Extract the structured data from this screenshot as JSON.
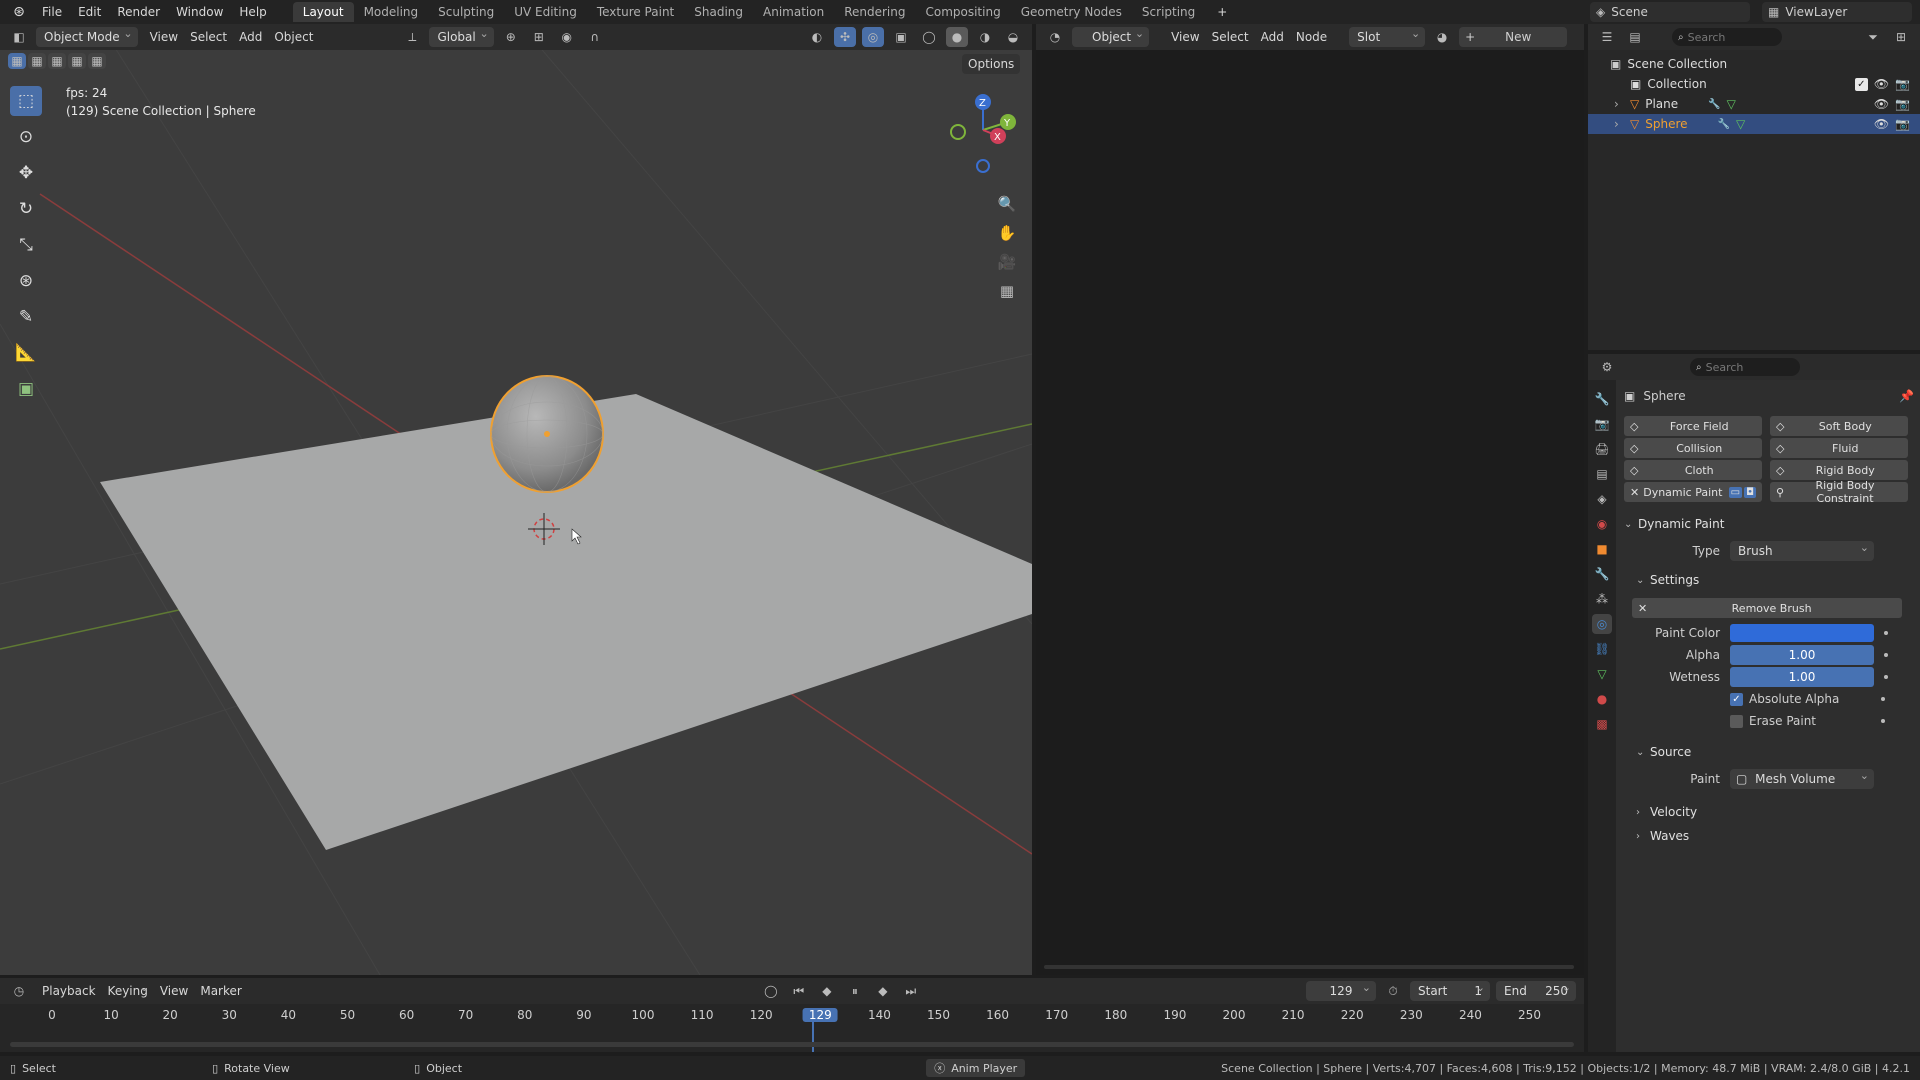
{
  "topbar": {
    "menus": [
      "File",
      "Edit",
      "Render",
      "Window",
      "Help"
    ],
    "workspaces": [
      "Layout",
      "Modeling",
      "Sculpting",
      "UV Editing",
      "Texture Paint",
      "Shading",
      "Animation",
      "Rendering",
      "Compositing",
      "Geometry Nodes",
      "Scripting"
    ],
    "active_workspace": "Layout",
    "add_tab": "+",
    "scene": "Scene",
    "view_layer": "ViewLayer"
  },
  "viewport": {
    "mode": "Object Mode",
    "menus": [
      "View",
      "Select",
      "Add",
      "Object"
    ],
    "transform": "Global",
    "options": "Options",
    "fps": "fps: 24",
    "info": "(129) Scene Collection | Sphere",
    "gizmo": {
      "x": "X",
      "y": "Y",
      "z": "Z"
    }
  },
  "node_editor": {
    "type": "Object",
    "menus": [
      "View",
      "Select",
      "Add",
      "Node"
    ],
    "slot": "Slot",
    "new_label": "New"
  },
  "outliner": {
    "search_placeholder": "Search",
    "root": "Scene Collection",
    "collection": "Collection",
    "items": [
      "Plane",
      "Sphere"
    ],
    "selected": "Sphere"
  },
  "properties": {
    "search_placeholder": "Search",
    "object_name": "Sphere",
    "physics_buttons": [
      {
        "left": "Force Field",
        "right": "Soft Body"
      },
      {
        "left": "Collision",
        "right": "Fluid"
      },
      {
        "left": "Cloth",
        "right": "Rigid Body"
      }
    ],
    "dynamic_paint_btn": "Dynamic Paint",
    "rigid_body_constraint": "Rigid Body Constraint",
    "panel_title": "Dynamic Paint",
    "type_label": "Type",
    "type_value": "Brush",
    "settings": "Settings",
    "remove_brush": "Remove Brush",
    "paint_color_label": "Paint Color",
    "paint_color": "#2f6bd9",
    "alpha_label": "Alpha",
    "alpha": "1.00",
    "wetness_label": "Wetness",
    "wetness": "1.00",
    "absolute_alpha": "Absolute Alpha",
    "erase_paint": "Erase Paint",
    "source": "Source",
    "paint_label": "Paint",
    "paint_value": "Mesh Volume",
    "velocity": "Velocity",
    "waves": "Waves"
  },
  "timeline": {
    "menus": [
      "Playback",
      "Keying",
      "View",
      "Marker"
    ],
    "current_frame": "129",
    "start_label": "Start",
    "start": "1",
    "end_label": "End",
    "end": "250",
    "ticks": [
      "0",
      "10",
      "20",
      "30",
      "40",
      "50",
      "60",
      "70",
      "80",
      "90",
      "100",
      "110",
      "120",
      "129",
      "140",
      "150",
      "160",
      "170",
      "180",
      "190",
      "200",
      "210",
      "220",
      "230",
      "240",
      "250"
    ]
  },
  "statusbar": {
    "select": "Select",
    "rotate": "Rotate View",
    "object": "Object",
    "anim_player": "Anim Player",
    "stats": "Scene Collection | Sphere | Verts:4,707 | Faces:4,608 | Tris:9,152 | Objects:1/2 | Memory: 48.7 MiB | VRAM: 2.4/8.0 GiB | 4.2.1"
  }
}
